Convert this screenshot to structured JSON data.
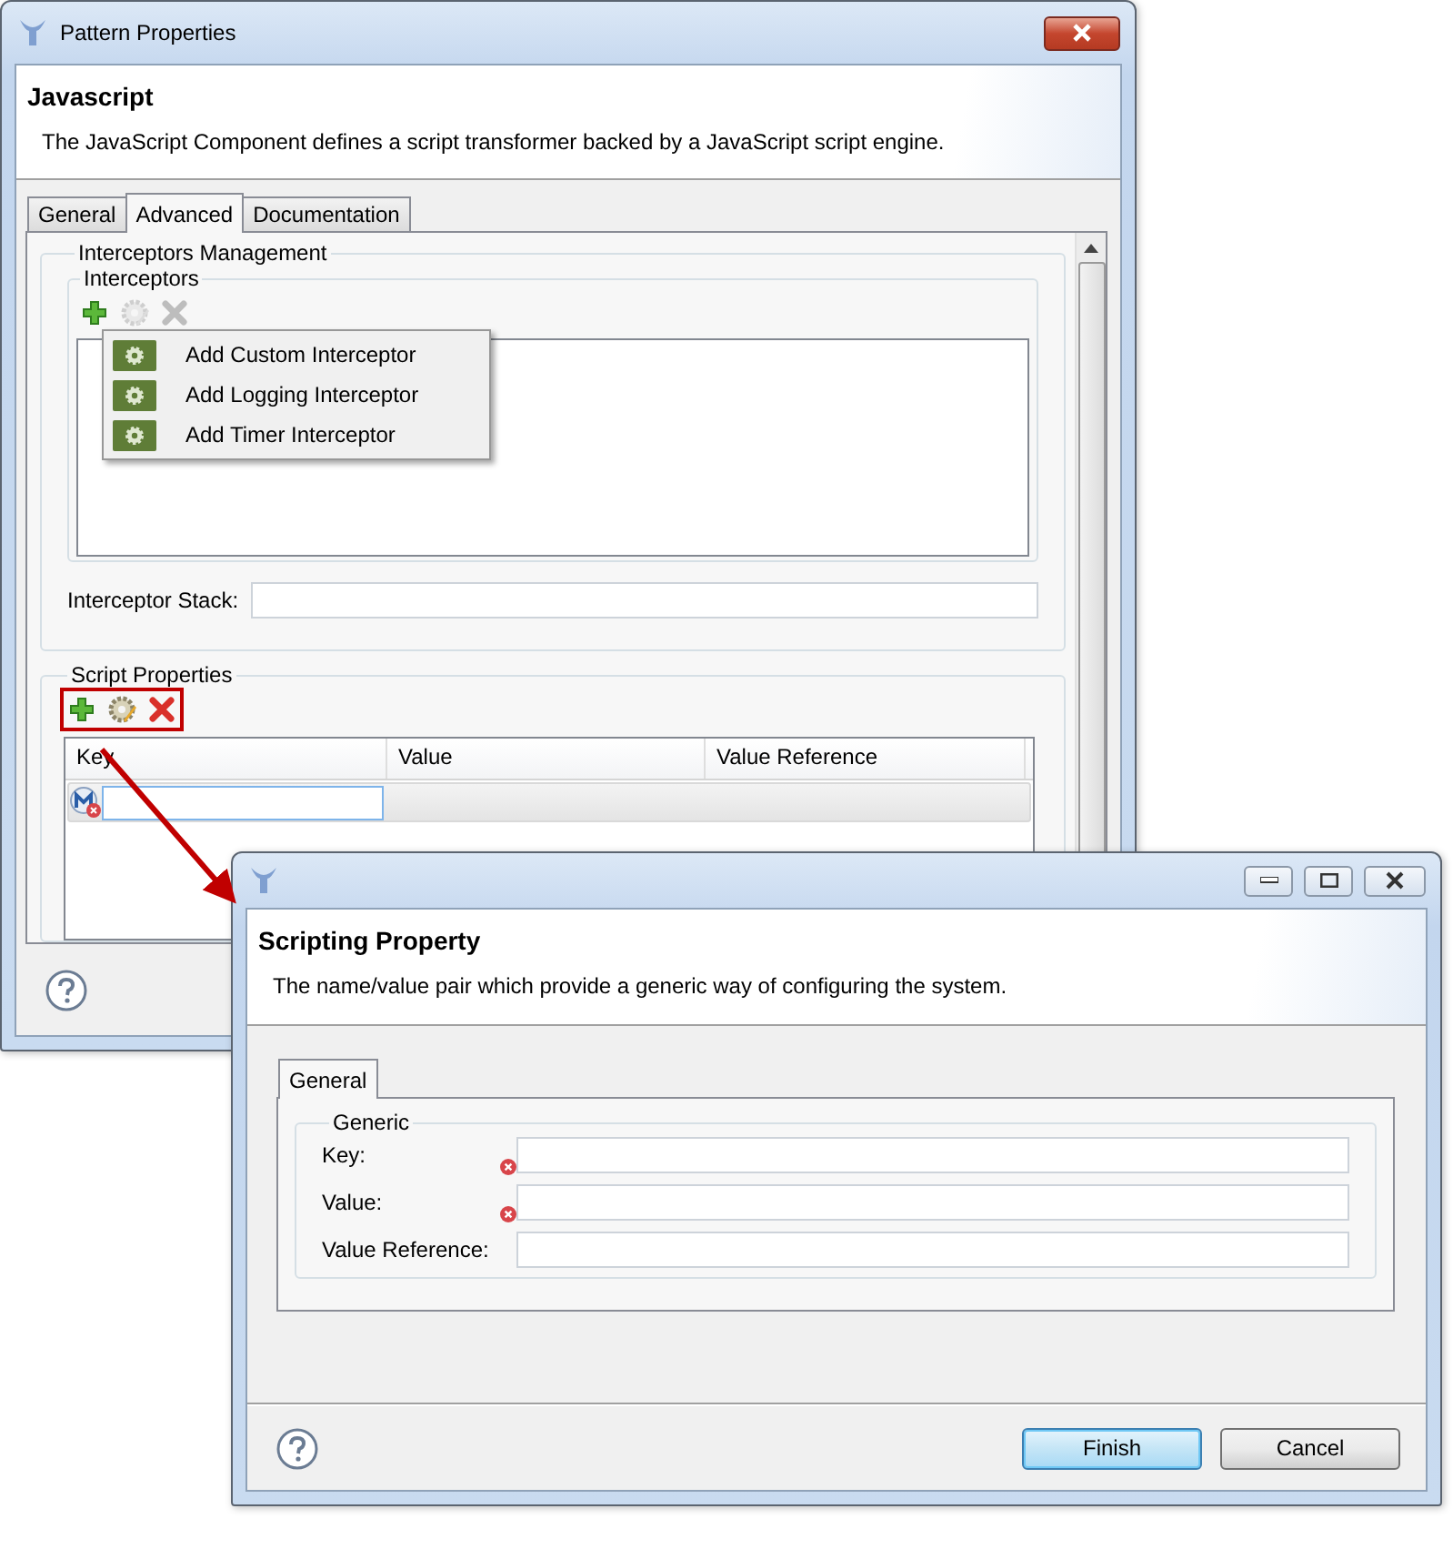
{
  "main_dialog": {
    "title": "Pattern Properties",
    "heading": "Javascript",
    "description": "The JavaScript Component defines a script transformer backed by a JavaScript script engine.",
    "tabs": [
      {
        "label": "General",
        "selected": false
      },
      {
        "label": "Advanced",
        "selected": true
      },
      {
        "label": "Documentation",
        "selected": false
      }
    ],
    "interceptors_management": {
      "title": "Interceptors Management",
      "interceptors_title": "Interceptors",
      "toolbar": [
        {
          "kind": "add",
          "disabled": false
        },
        {
          "kind": "edit",
          "disabled": true
        },
        {
          "kind": "delete",
          "disabled": true
        }
      ],
      "stack_label": "Interceptor Stack:"
    },
    "script_properties": {
      "title": "Script Properties",
      "callout": true,
      "toolbar": [
        {
          "kind": "add",
          "disabled": false
        },
        {
          "kind": "edit",
          "disabled": false
        },
        {
          "kind": "delete",
          "disabled": false
        }
      ],
      "columns": [
        "Key",
        "Value",
        "Value Reference"
      ],
      "rows": [
        {
          "error": true
        }
      ]
    }
  },
  "menu": {
    "items": [
      "Add Custom Interceptor",
      "Add Logging Interceptor",
      "Add Timer Interceptor"
    ]
  },
  "property_dialog": {
    "heading": "Scripting Property",
    "description": "The name/value pair which provide a generic way of configuring the system.",
    "tabs": [
      {
        "label": "General",
        "selected": true
      }
    ],
    "group_title": "Generic",
    "fields": [
      {
        "label": "Key:",
        "error": true
      },
      {
        "label": "Value:",
        "error": true
      },
      {
        "label": "Value Reference:",
        "error": false
      }
    ],
    "buttons": [
      {
        "label": "Finish",
        "default": true
      },
      {
        "label": "Cancel",
        "default": false
      }
    ]
  }
}
